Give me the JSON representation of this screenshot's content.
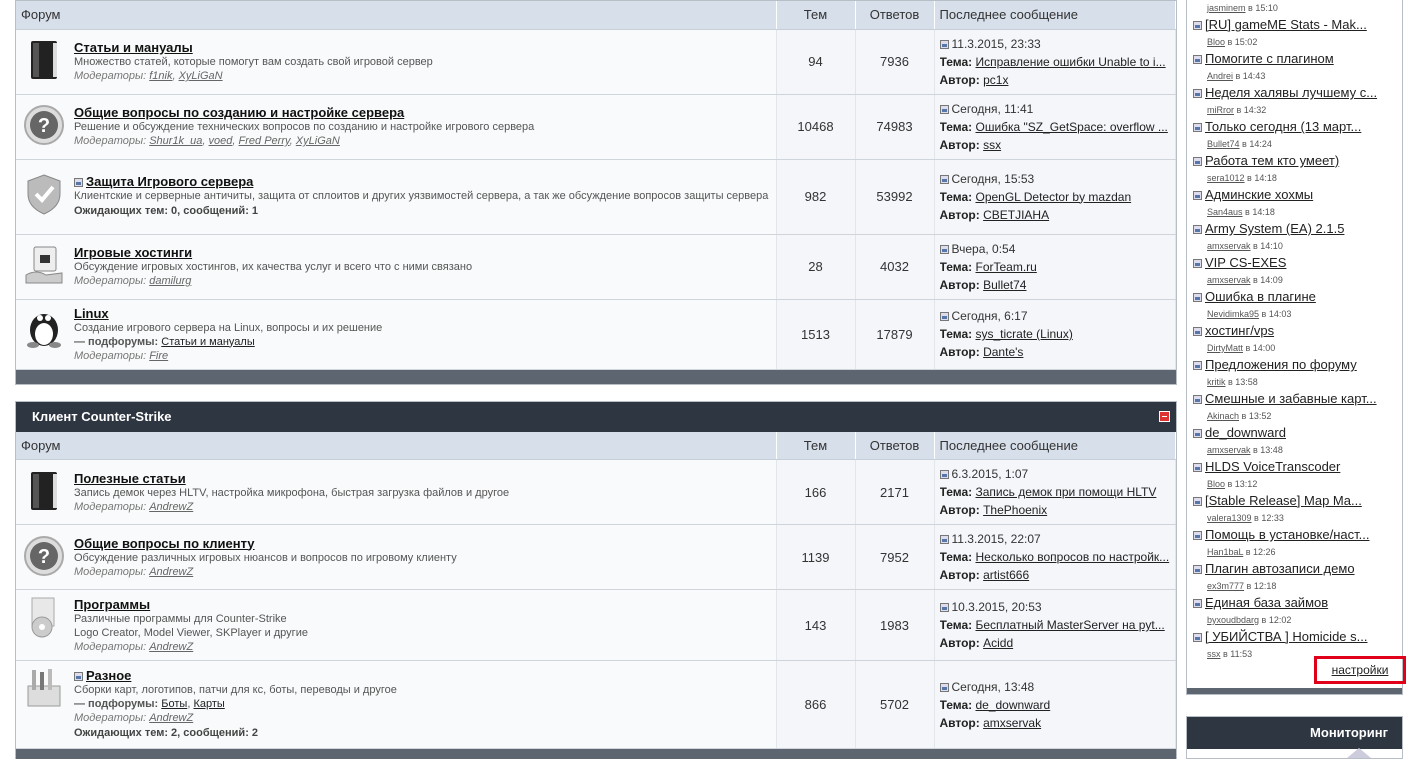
{
  "headers": {
    "forum": "Форум",
    "topics": "Тем",
    "replies": "Ответов",
    "last": "Последнее сообщение"
  },
  "labels": {
    "topic": "Тема:",
    "author": "Автор:",
    "mods": "Модераторы:",
    "subforums": "— подфорумы:"
  },
  "section1": {
    "forums": [
      {
        "icon": "book-icon",
        "title": "Статьи и мануалы",
        "desc": "Множество статей, которые помогут вам создать свой игровой сервер",
        "mods": [
          "f1nik",
          "XyLiGaN"
        ],
        "topics": "94",
        "replies": "7936",
        "date": "11.3.2015, 23:33",
        "topic": "Исправление ошибки Unable to i...",
        "author": "pc1x"
      },
      {
        "icon": "question-icon",
        "title": "Общие вопросы по созданию и настройке сервера",
        "desc": "Решение и обсуждение технических вопросов по созданию и настройке игрового сервера",
        "mods": [
          "Shur1k_ua",
          "voed",
          "Fred Perry",
          "XyLiGaN"
        ],
        "topics": "10468",
        "replies": "74983",
        "date": "Сегодня, 11:41",
        "topic": "Ошибка \"SZ_GetSpace: overflow ...",
        "author": "ssx"
      },
      {
        "icon": "shield-icon",
        "title": "Защита Игрового сервера",
        "desc": "Клиентские и серверные античиты, защита от сплоитов и других уязвимостей сервера, а так же обсуждение вопросов защиты сервера",
        "pending": "Ожидающих тем: 0, сообщений: 1",
        "topics": "982",
        "replies": "53992",
        "date": "Сегодня, 15:53",
        "topic": "OpenGL Detector by mazdan",
        "author": "CBETJIAHA"
      },
      {
        "icon": "hosting-icon",
        "title": "Игровые хостинги",
        "desc": "Обсуждение игровых хостингов, их качества услуг и всего что с ними связано",
        "mods": [
          "damilurg"
        ],
        "topics": "28",
        "replies": "4032",
        "date": "Вчера, 0:54",
        "topic": "ForTeam.ru",
        "author": "Bullet74"
      },
      {
        "icon": "linux-penguin-icon",
        "title": "Linux",
        "desc": "Создание игрового сервера на Linux, вопросы и их решение",
        "subforums": [
          "Статьи и мануалы"
        ],
        "mods": [
          "Fire"
        ],
        "topics": "1513",
        "replies": "17879",
        "date": "Сегодня, 6:17",
        "topic": "sys_ticrate (Linux)",
        "author": "Dante's"
      }
    ]
  },
  "section2": {
    "title": "Клиент Counter-Strike",
    "forums": [
      {
        "icon": "book-icon",
        "title": "Полезные статьи",
        "desc": "Запись демок через HLTV, настройка микрофона, быстрая загрузка файлов и другое",
        "mods": [
          "AndrewZ"
        ],
        "topics": "166",
        "replies": "2171",
        "date": "6.3.2015, 1:07",
        "topic": "Запись демок при помощи HLTV",
        "author": "ThePhoenix"
      },
      {
        "icon": "question-icon",
        "title": "Общие вопросы по клиенту",
        "desc": "Обсуждение различных игровых нюансов и вопросов по игровому клиенту",
        "mods": [
          "AndrewZ"
        ],
        "topics": "1139",
        "replies": "7952",
        "date": "11.3.2015, 22:07",
        "topic": "Несколько вопросов по настройк...",
        "author": "artist666"
      },
      {
        "icon": "software-cd-icon",
        "title": "Программы",
        "desc": "Различные программы для Counter-Strike",
        "desc2": "Logo Creator, Model Viewer, SKPlayer и другие",
        "mods": [
          "AndrewZ"
        ],
        "topics": "143",
        "replies": "1983",
        "date": "10.3.2015, 20:53",
        "topic": "Бесплатный MasterServer на pyt...",
        "author": "Acidd"
      },
      {
        "icon": "toolbox-icon",
        "title": "Разное",
        "desc": "Сборки карт, логотипов, патчи для кс, боты, переводы и другое",
        "subforums": [
          "Боты",
          "Карты"
        ],
        "mods": [
          "AndrewZ"
        ],
        "pending": "Ожидающих тем: 2, сообщений: 2",
        "topics": "866",
        "replies": "5702",
        "date": "Сегодня, 13:48",
        "topic": "de_downward",
        "author": "amxservak"
      }
    ]
  },
  "sidebar": {
    "top_meta": {
      "user": "jasminem",
      "time": "в 15:10"
    },
    "items": [
      {
        "topic": "[RU] gameME Stats - Mak...",
        "user": "Bloo",
        "time": "в 15:02"
      },
      {
        "topic": "Помогите с плагином",
        "user": "Andrei",
        "time": "в 14:43"
      },
      {
        "topic": "Неделя халявы лучшему с...",
        "user": "miRror",
        "time": "в 14:32"
      },
      {
        "topic": "Только сегодня (13 март...",
        "user": "Bullet74",
        "time": "в 14:24"
      },
      {
        "topic": "Работа тем кто умеет)",
        "user": "sera1012",
        "time": "в 14:18"
      },
      {
        "topic": "Админские хохмы",
        "user": "San4aus",
        "time": "в 14:18"
      },
      {
        "topic": "Army System (EA) 2.1.5",
        "user": "amxservak",
        "time": "в 14:10"
      },
      {
        "topic": "VIP CS-EXES",
        "user": "amxservak",
        "time": "в 14:09"
      },
      {
        "topic": "Ошибка в плагине",
        "user": "Nevidimka95",
        "time": "в 14:03"
      },
      {
        "topic": "хостинг/vps",
        "user": "DirtyMatt",
        "time": "в 14:00"
      },
      {
        "topic": "Предложения по форуму",
        "user": "kritik",
        "time": "в 13:58"
      },
      {
        "topic": "Смешные и забавные карт...",
        "user": "Akinach",
        "time": "в 13:52"
      },
      {
        "topic": "de_downward",
        "user": "amxservak",
        "time": "в 13:48"
      },
      {
        "topic": "HLDS VoiceTranscoder",
        "user": "Bloo",
        "time": "в 13:12"
      },
      {
        "topic": "[Stable Release] Map Ma...",
        "user": "valera1309",
        "time": "в 12:33"
      },
      {
        "topic": "Помощь в установке/наст...",
        "user": "Han1baL",
        "time": "в 12:26"
      },
      {
        "topic": "Плагин автозаписи демо",
        "user": "ex3m777",
        "time": "в 12:18"
      },
      {
        "topic": "Единая база займов",
        "user": "byxoudbdarg",
        "time": "в 12:02"
      },
      {
        "topic": "[ УБИЙСТВА ] Homicide s...",
        "user": "ssx",
        "time": "в 11:53"
      }
    ],
    "settings": "настройки"
  },
  "monitoring": {
    "title": "Мониторинг"
  }
}
